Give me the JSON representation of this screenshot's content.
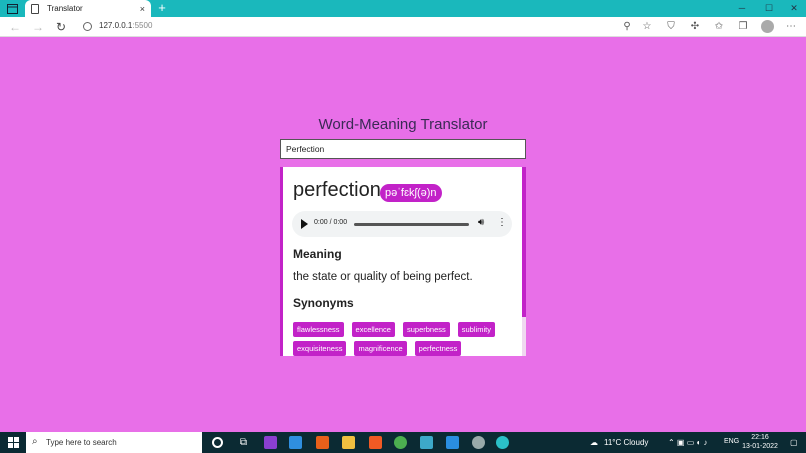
{
  "browser": {
    "tab_title": "Translator",
    "tab_close": "×",
    "new_tab": "+",
    "url_host": "127.0.0.1",
    "url_port": ":5500",
    "window_controls": {
      "minimize": "─",
      "maximize": "☐",
      "close": "✕"
    }
  },
  "app": {
    "title": "Word-Meaning Translator",
    "search_value": "Perfection"
  },
  "result": {
    "word": "perfection",
    "phonetic": "pəˈfɛkʃ(ə)n",
    "audio_time": "0:00 / 0:00",
    "meaning_heading": "Meaning",
    "meaning": "the state or quality of being perfect.",
    "synonyms_heading": "Synonyms",
    "synonyms": [
      "flawlessness",
      "excellence",
      "superbness",
      "sublimity",
      "exquisiteness",
      "magnificence",
      "perfectness"
    ]
  },
  "taskbar": {
    "search_placeholder": "Type here to search",
    "weather": "11°C  Cloudy",
    "language": "ENG",
    "time": "22:16",
    "date": "13-01-2022"
  },
  "colors": {
    "page_background": "#e86fe8",
    "accent": "#c222c8",
    "tab_strip": "#1ab8bc",
    "taskbar": "#0b2a33"
  }
}
